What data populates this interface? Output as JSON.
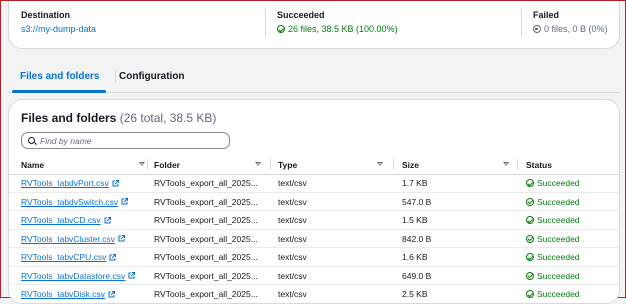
{
  "summary": {
    "destination": {
      "label": "Destination",
      "value": "s3://my-dump-data"
    },
    "succeeded": {
      "label": "Succeeded",
      "value": "26 files, 38.5 KB (100.00%)"
    },
    "failed": {
      "label": "Failed",
      "value": "0 files, 0 B (0%)"
    }
  },
  "tabs": [
    {
      "label": "Files and folders",
      "active": true
    },
    {
      "label": "Configuration",
      "active": false
    }
  ],
  "files": {
    "title": "Files and folders",
    "count": "(26 total, 38.5 KB)",
    "search_placeholder": "Find by name",
    "columns": [
      "Name",
      "Folder",
      "Type",
      "Size",
      "Status"
    ],
    "rows": [
      {
        "name": "RVTools_tabdvPort.csv",
        "folder": "RVTools_export_all_2025...",
        "type": "text/csv",
        "size": "1.7 KB",
        "status": "Succeeded"
      },
      {
        "name": "RVTools_tabdvSwitch.csv",
        "folder": "RVTools_export_all_2025...",
        "type": "text/csv",
        "size": "547.0 B",
        "status": "Succeeded"
      },
      {
        "name": "RVTools_tabvCD.csv",
        "folder": "RVTools_export_all_2025...",
        "type": "text/csv",
        "size": "1.5 KB",
        "status": "Succeeded"
      },
      {
        "name": "RVTools_tabvCluster.csv",
        "folder": "RVTools_export_all_2025...",
        "type": "text/csv",
        "size": "842.0 B",
        "status": "Succeeded"
      },
      {
        "name": "RVTools_tabvCPU.csv",
        "folder": "RVTools_export_all_2025...",
        "type": "text/csv",
        "size": "1.6 KB",
        "status": "Succeeded"
      },
      {
        "name": "RVTools_tabvDatastore.csv",
        "folder": "RVTools_export_all_2025...",
        "type": "text/csv",
        "size": "649.0 B",
        "status": "Succeeded"
      },
      {
        "name": "RVTools_tabvDisk.csv",
        "folder": "RVTools_export_all_2025...",
        "type": "text/csv",
        "size": "2.5 KB",
        "status": "Succeeded"
      }
    ]
  },
  "colors": {
    "link": "#0972d3",
    "success": "#037f0c",
    "border": "#d5dbdb",
    "background": "#f2f3f3"
  },
  "icons": [
    "success-circle-icon",
    "neutral-circle-icon",
    "search-icon",
    "external-link-icon",
    "sort-caret-icon"
  ]
}
